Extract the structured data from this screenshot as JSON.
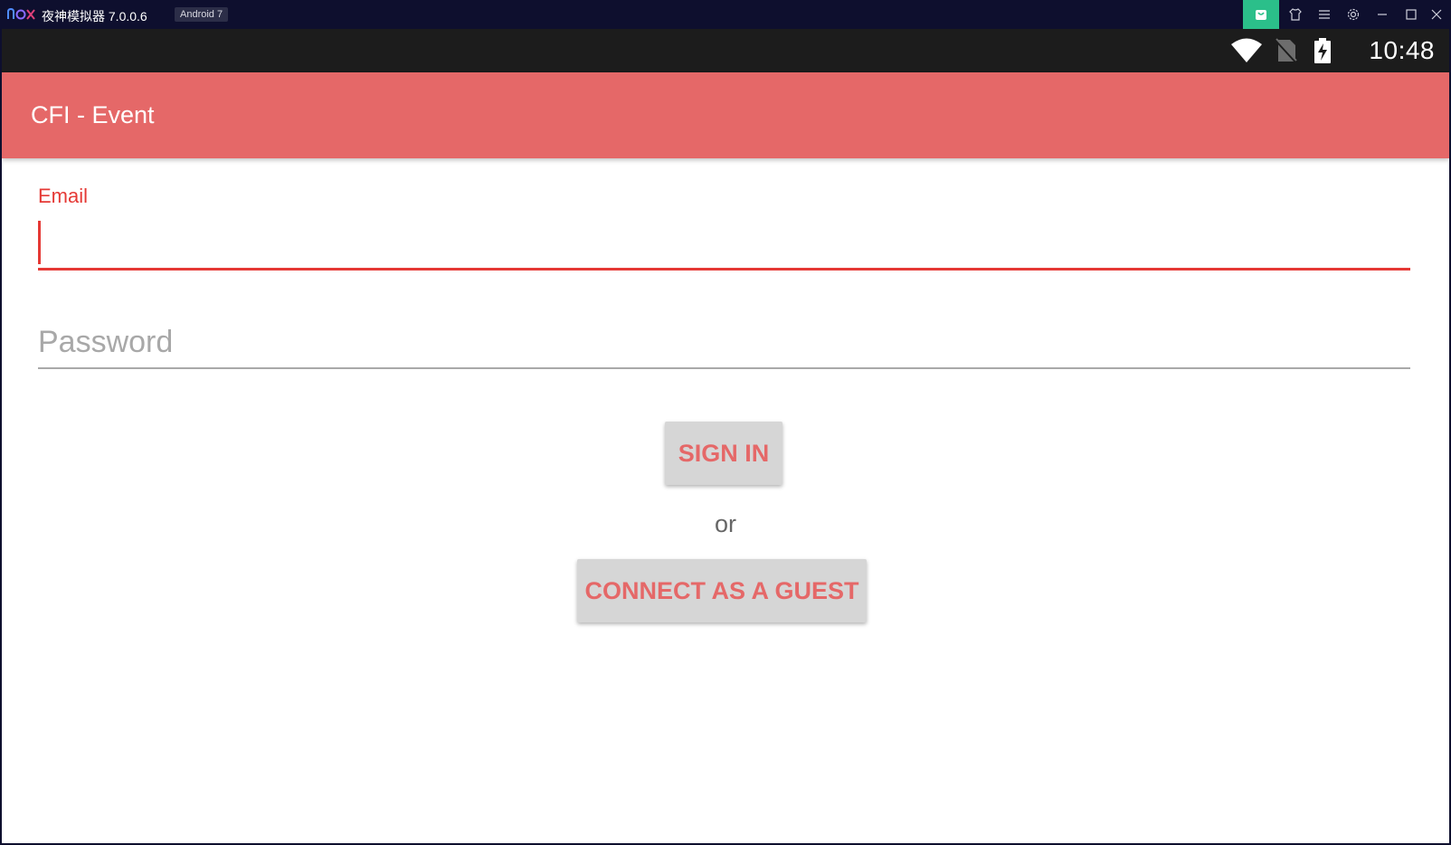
{
  "emulator": {
    "logo_text": "nox",
    "title": "夜神模拟器 7.0.0.6",
    "version_badge": "Android 7",
    "controls": [
      "store-icon",
      "shirt-icon",
      "menu-icon",
      "gear-icon",
      "minimize-icon",
      "maximize-icon",
      "close-icon"
    ],
    "store_color": "#2bbf8a"
  },
  "status_bar": {
    "time": "10:48",
    "icons": [
      "wifi-icon",
      "no-sim-icon",
      "battery-charging-icon"
    ]
  },
  "app_bar": {
    "title": "CFI - Event",
    "color": "#e56868"
  },
  "form": {
    "email_label": "Email",
    "email_value": "",
    "password_placeholder": "Password",
    "accent_color": "#e53935"
  },
  "actions": {
    "sign_in_label": "SIGN IN",
    "or_text": "or",
    "guest_label": "CONNECT AS A GUEST"
  }
}
